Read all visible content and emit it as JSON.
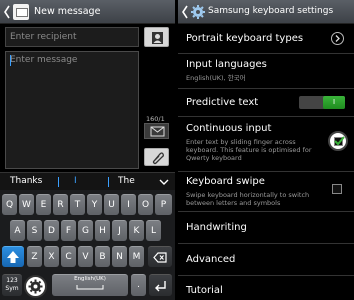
{
  "left": {
    "title": "New message",
    "recipient_placeholder": "Enter recipient",
    "message_placeholder": "Enter message",
    "counter": "160/1",
    "suggestions": [
      "Thanks",
      "I",
      "The"
    ],
    "keys": {
      "row1": [
        "Q",
        "W",
        "E",
        "R",
        "T",
        "Y",
        "U",
        "I",
        "O",
        "P"
      ],
      "row2": [
        "A",
        "S",
        "D",
        "F",
        "G",
        "H",
        "J",
        "K",
        "L"
      ],
      "row3": [
        "Z",
        "X",
        "C",
        "V",
        "B",
        "N",
        "M"
      ],
      "sym_top": "123",
      "sym_bottom": "Sym",
      "space": "English(UK)",
      "period": "."
    }
  },
  "right": {
    "title": "Samsung keyboard settings",
    "items": [
      {
        "label": "Portrait keyboard types"
      },
      {
        "label": "Input languages",
        "sub": "English(UK), 한국어"
      },
      {
        "label": "Predictive text",
        "toggle": "I"
      },
      {
        "label": "Continuous input",
        "sub": "Enter text by sliding finger across keyboard. This feature is optimised for Qwerty keyboard"
      },
      {
        "label": "Keyboard swipe",
        "sub": "Swipe keyboard horizontally to switch between letters and symbols"
      },
      {
        "label": "Handwriting"
      },
      {
        "label": "Advanced"
      },
      {
        "label": "Tutorial"
      }
    ]
  }
}
